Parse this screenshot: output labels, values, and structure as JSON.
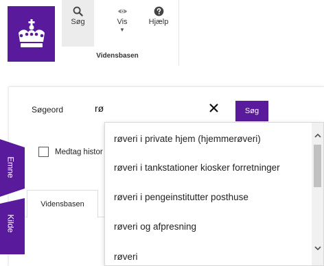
{
  "ribbon": {
    "search_label": "Søg",
    "view_label": "Vis",
    "help_label": "Hjælp",
    "group_label": "Vidensbasen"
  },
  "search": {
    "label": "Søgeord",
    "value": "rø",
    "button_label": "Søg"
  },
  "options": {
    "include_history_label": "Medtag histor",
    "include_history_checked": false
  },
  "tabs": [
    {
      "label": "Vidensbasen"
    }
  ],
  "side_tabs": {
    "topic_label": "Emne",
    "source_label": "Kilde"
  },
  "autocomplete": {
    "items": [
      "røveri i private hjem (hjemmerøveri)",
      "røveri i tankstationer kiosker forretninger",
      "røveri i pengeinstitutter posthuse",
      "røveri og afpresning",
      "røveri"
    ]
  },
  "colors": {
    "brand": "#5a1a9c"
  }
}
